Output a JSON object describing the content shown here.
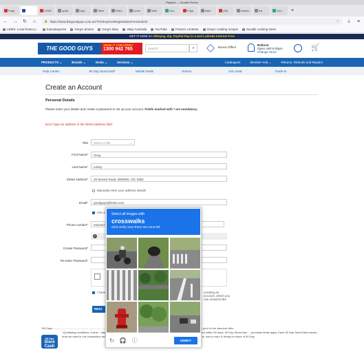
{
  "browser": {
    "window_title": "Register — Mozilla Firefox",
    "tabs": [
      {
        "label": "Fripp",
        "color": "#d33"
      },
      {
        "label": "",
        "color": "#2a4b9b",
        "active": true
      },
      {
        "label": "LEMS",
        "color": "#d33"
      },
      {
        "label": "upda",
        "color": "#888"
      },
      {
        "label": "Upd",
        "color": "#888"
      },
      {
        "label": "Stem",
        "color": "#888"
      },
      {
        "label": "Robo",
        "color": "#888"
      },
      {
        "label": "Lemo",
        "color": "#888"
      },
      {
        "label": "Wee",
        "color": "#888"
      },
      {
        "label": "Goo",
        "color": "#3a7"
      },
      {
        "label": "Fripp",
        "color": "#d33"
      },
      {
        "label": "Nam",
        "color": "#888"
      },
      {
        "label": "(39)",
        "color": "#d33"
      },
      {
        "label": "rearea",
        "color": "#888"
      },
      {
        "label": "ext",
        "color": "#888"
      },
      {
        "label": "Goo",
        "color": "#3a7"
      }
    ],
    "url": "https://www.thegoodguys.com.au/TGGExpressRegistrationFormSubmit",
    "bookmarks": [
      "LEMS: Local home p...",
      "Subcategories",
      "Greg's photos",
      "Greg's diary",
      "eBay Australia",
      "YouTube",
      "Freezer contents",
      "Greg's cooking recipes",
      "Noodle cooking times"
    ]
  },
  "site": {
    "promo_prefix": "GET IT NOW on",
    "promo_links": "Afterpay, Zip, PayPal Pay in 4 and Latitude Interest Free",
    "logo": "THE GOOD GUYS",
    "seen_line1": "SEEN IT CHEAPER?",
    "seen_line2": "1300 942 765",
    "search_placeholder": "Search",
    "bonus_offers": "Bonus Offers",
    "store_name": "Ballarat",
    "store_hours": "Open until 5:00pm",
    "store_change": "Change Store",
    "main_nav_left": [
      "PRODUCTS ⌄",
      "Brands ⌄",
      "Deals ⌄",
      "Services ⌄"
    ],
    "main_nav_right": [
      "Catalogues",
      "Member Hub ⌄",
      "Returns, Refunds and Repairs"
    ],
    "sub_nav": [
      "Help Centre",
      "90 Day StoreCash*",
      "Mobile Deals",
      "Kinnon",
      "AOL Deal",
      "Trade-In"
    ]
  },
  "form": {
    "heading": "Create an Account",
    "section": "Personal Details",
    "intro": "Please enter your details and create a password to set up your account.",
    "intro_bold": "Fields marked with * are mandatory.",
    "error": "Error:Type an address in the Street address field.",
    "title_label": "Title",
    "title_value": "Select a title",
    "first_name_label": "First Name*",
    "first_name_value": "Greg",
    "last_name_label": "Last Name*",
    "last_name_value": "Lehey",
    "street_label": "Street Address*",
    "street_value": "29 Stones Road, DEREEL VIC 3352",
    "manual_address": "Manually enter your address details",
    "email_label": "Email*",
    "email_value": "goodguys@lemis.com",
    "use_label": "Use a",
    "phone_label": "Phone number*",
    "phone_value": "04xx347",
    "info_prefix": "i",
    "create_pw_label": "Create Password*",
    "reenter_pw_label": "Re-enter Password*",
    "terms_text": "I have",
    "terms_tail": "creating an account, which you can unsubscribe",
    "register_label": "REGI",
    "footnote1": "*90 Days",
    "footnote1_tail": "been sold below ticketed/advertised price prior to the discount offer.",
    "footnote2": "+Qualifying conditions, includ...  eligible to earn/win and where a qualifying purchase is required, collecting the product within 60 days. 90 Day StoreCash ...  purchase limits apply. Each 90 Day StoreCash reward must be used in one transaction and no change/credit for any unuse...  eceive 90 Day StoreCash deposit notifications, how to earn & timing for issue of 90 Day",
    "badge_line1": "90 Day",
    "badge_line2": "Store",
    "badge_line3": "Cash"
  },
  "captcha": {
    "line1": "Select all images with",
    "line2": "crosswalks",
    "line3": "Click verify once there are none left.",
    "verify_label": "VERIFY",
    "tiles": [
      "motorcyclist on road",
      "tunnel entrance",
      "road with crosswalk",
      "crosswalk stripes",
      "grass and trees",
      "road markings",
      "fire hydrant",
      "trees and grass",
      "road with cars"
    ]
  }
}
